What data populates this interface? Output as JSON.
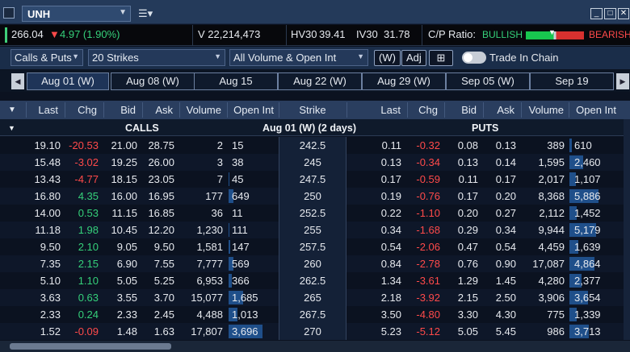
{
  "title": {
    "symbol": "UNH"
  },
  "quote": {
    "last": "266.04",
    "change": "4.97 (1.90%)",
    "volume": "V 22,214,473",
    "hv30_label": "HV30",
    "hv30": "39.41",
    "iv30_label": "IV30",
    "iv30": "31.78",
    "cp_label": "C/P Ratio:",
    "bullish": "BULLISH",
    "bearish": "BEARISH"
  },
  "toolbar": {
    "type_select": "Calls & Puts",
    "strikes_select": "20 Strikes",
    "filter_select": "All Volume & Open Int",
    "w_button": "(W)",
    "adj_button": "Adj",
    "trade_in_chain": "Trade In Chain"
  },
  "expirations": [
    "Aug 01 (W)",
    "Aug 08 (W)",
    "Aug 15",
    "Aug 22 (W)",
    "Aug 29 (W)",
    "Sep 05 (W)",
    "Sep 19"
  ],
  "columns": {
    "calls": [
      "Last",
      "Chg",
      "Bid",
      "Ask",
      "Volume",
      "Open Int"
    ],
    "strike": "Strike",
    "puts": [
      "Last",
      "Chg",
      "Bid",
      "Ask",
      "Volume",
      "Open Int"
    ]
  },
  "sections": {
    "calls": "CALLS",
    "expiry": "Aug 01 (W) (2 days)",
    "puts": "PUTS"
  },
  "colors": {
    "positive": "#35d07a",
    "negative": "#ff4a4a",
    "volume_bar": "#1f4f8a"
  },
  "rows": [
    {
      "strike": "242.5",
      "call": [
        "19.10",
        "-20.53",
        "21.00",
        "28.75",
        "2",
        "15"
      ],
      "put": [
        "0.11",
        "-0.32",
        "0.08",
        "0.13",
        "389",
        "610"
      ],
      "call_bar": 0.0,
      "put_bar": 0.05
    },
    {
      "strike": "245",
      "call": [
        "15.48",
        "-3.02",
        "19.25",
        "26.00",
        "3",
        "38"
      ],
      "put": [
        "0.13",
        "-0.34",
        "0.13",
        "0.14",
        "1,595",
        "2,460"
      ],
      "call_bar": 0.0,
      "put_bar": 0.25
    },
    {
      "strike": "247.5",
      "call": [
        "13.43",
        "-4.77",
        "18.15",
        "23.05",
        "7",
        "45"
      ],
      "put": [
        "0.17",
        "-0.59",
        "0.11",
        "0.17",
        "2,017",
        "1,107"
      ],
      "call_bar": 0.01,
      "put_bar": 0.12
    },
    {
      "strike": "250",
      "call": [
        "16.80",
        "4.35",
        "16.00",
        "16.95",
        "177",
        "649"
      ],
      "put": [
        "0.19",
        "-0.76",
        "0.17",
        "0.20",
        "8,368",
        "5,886"
      ],
      "call_bar": 0.1,
      "put_bar": 0.55
    },
    {
      "strike": "252.5",
      "call": [
        "14.00",
        "0.53",
        "11.15",
        "16.85",
        "36",
        "11"
      ],
      "put": [
        "0.22",
        "-1.10",
        "0.20",
        "0.27",
        "2,112",
        "1,452"
      ],
      "call_bar": 0.0,
      "put_bar": 0.14
    },
    {
      "strike": "255",
      "call": [
        "11.18",
        "1.98",
        "10.45",
        "12.20",
        "1,230",
        "111"
      ],
      "put": [
        "0.34",
        "-1.68",
        "0.29",
        "0.34",
        "9,944",
        "5,179"
      ],
      "call_bar": 0.02,
      "put_bar": 0.5
    },
    {
      "strike": "257.5",
      "call": [
        "9.50",
        "2.10",
        "9.05",
        "9.50",
        "1,581",
        "147"
      ],
      "put": [
        "0.54",
        "-2.06",
        "0.47",
        "0.54",
        "4,459",
        "1,639"
      ],
      "call_bar": 0.03,
      "put_bar": 0.16
    },
    {
      "strike": "260",
      "call": [
        "7.35",
        "2.15",
        "6.90",
        "7.55",
        "7,777",
        "569"
      ],
      "put": [
        "0.84",
        "-2.78",
        "0.76",
        "0.90",
        "17,087",
        "4,864"
      ],
      "call_bar": 0.1,
      "put_bar": 0.47
    },
    {
      "strike": "262.5",
      "call": [
        "5.10",
        "1.10",
        "5.05",
        "5.25",
        "6,953",
        "366"
      ],
      "put": [
        "1.34",
        "-3.61",
        "1.29",
        "1.45",
        "4,280",
        "2,377"
      ],
      "call_bar": 0.06,
      "put_bar": 0.23
    },
    {
      "strike": "265",
      "call": [
        "3.63",
        "0.63",
        "3.55",
        "3.70",
        "15,077",
        "1,685"
      ],
      "put": [
        "2.18",
        "-3.92",
        "2.15",
        "2.50",
        "3,906",
        "3,654"
      ],
      "call_bar": 0.3,
      "put_bar": 0.35
    },
    {
      "strike": "267.5",
      "call": [
        "2.33",
        "0.24",
        "2.33",
        "2.45",
        "4,488",
        "1,013"
      ],
      "put": [
        "3.50",
        "-4.80",
        "3.30",
        "4.30",
        "775",
        "1,339"
      ],
      "call_bar": 0.18,
      "put_bar": 0.13
    },
    {
      "strike": "270",
      "call": [
        "1.52",
        "-0.09",
        "1.48",
        "1.63",
        "17,807",
        "3,696"
      ],
      "put": [
        "5.23",
        "-5.12",
        "5.05",
        "5.45",
        "986",
        "3,713"
      ],
      "call_bar": 0.7,
      "put_bar": 0.36
    }
  ]
}
